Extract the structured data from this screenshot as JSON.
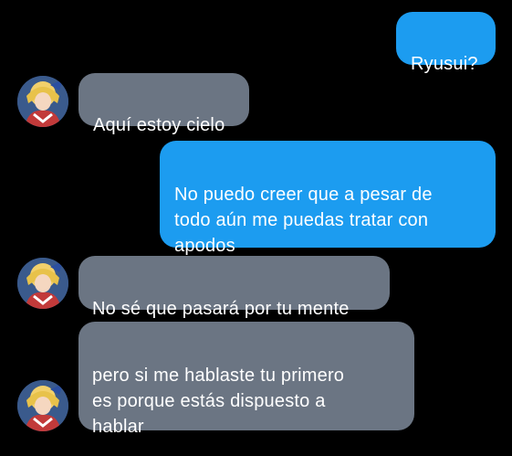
{
  "conversation": {
    "messages": [
      {
        "sender": "me",
        "text": "Ryusui?"
      },
      {
        "sender": "contact",
        "text": "Aquí estoy cielo"
      },
      {
        "sender": "me",
        "text": "No puedo creer que a pesar de\ntodo aún me puedas tratar con\napodos"
      },
      {
        "sender": "contact",
        "text": "No sé que pasará por tu mente"
      },
      {
        "sender": "contact",
        "text": "pero si me hablaste tu primero\nes porque estás dispuesto a\nhablar"
      }
    ]
  },
  "theme": {
    "background": "#000000",
    "outgoing_bubble": "#1c9cf0",
    "incoming_bubble": "#6b7583",
    "text": "#ffffff"
  },
  "contact": {
    "avatar_icon": "anime-character-avatar-icon"
  }
}
